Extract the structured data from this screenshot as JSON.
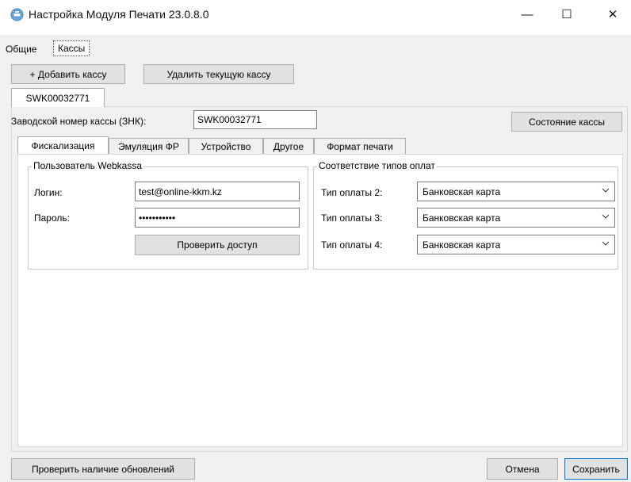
{
  "window": {
    "title": "Настройка Модуля Печати 23.0.8.0",
    "minimize_glyph": "—",
    "maximize_glyph": "☐",
    "close_glyph": "✕"
  },
  "top_tabs": [
    "Общие",
    "Кассы"
  ],
  "toolbar": {
    "add_label": "+ Добавить кассу",
    "delete_label": "Удалить текущую кассу"
  },
  "kassa_tab": "SWK00032771",
  "znk": {
    "label": "Заводской номер кассы (ЗНК):",
    "value": "SWK00032771",
    "status_button": "Состояние кассы"
  },
  "settings_tabs": [
    "Фискализация",
    "Эмуляция ФР",
    "Устройство",
    "Другое",
    "Формат печати"
  ],
  "webkassa": {
    "title": "Пользователь Webkassa",
    "login_label": "Логин:",
    "login_value": "test@online-kkm.kz",
    "password_label": "Пароль:",
    "password_value": "•••••••••••",
    "check_button": "Проверить доступ"
  },
  "payments": {
    "title": "Соответствие типов оплат",
    "rows": [
      {
        "label": "Тип оплаты 2:",
        "value": "Банковская карта"
      },
      {
        "label": "Тип оплаты 3:",
        "value": "Банковская карта"
      },
      {
        "label": "Тип оплаты 4:",
        "value": "Банковская карта"
      }
    ]
  },
  "footer": {
    "check_updates": "Проверить наличие обновлений",
    "cancel": "Отмена",
    "save": "Сохранить"
  },
  "colors": {
    "client_bg": "#f0f0f0",
    "button_bg": "#e1e1e1",
    "active_button_border": "#0078d7"
  }
}
